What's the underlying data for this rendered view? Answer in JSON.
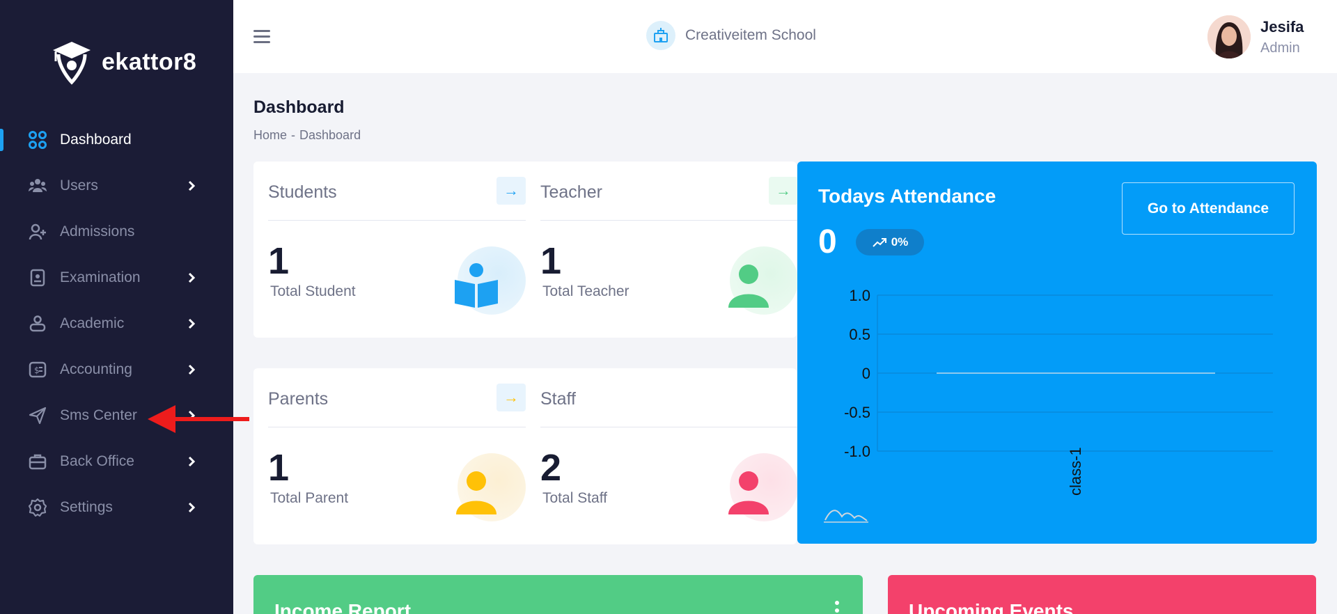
{
  "brand": {
    "name": "ekattor8"
  },
  "sidebar": {
    "items": [
      {
        "label": "Dashboard",
        "icon": "dashboard-grid-icon",
        "active": true,
        "has_submenu": false
      },
      {
        "label": "Users",
        "icon": "users-icon",
        "active": false,
        "has_submenu": true
      },
      {
        "label": "Admissions",
        "icon": "add-user-icon",
        "active": false,
        "has_submenu": false
      },
      {
        "label": "Examination",
        "icon": "exam-icon",
        "active": false,
        "has_submenu": true
      },
      {
        "label": "Academic",
        "icon": "academic-icon",
        "active": false,
        "has_submenu": true
      },
      {
        "label": "Accounting",
        "icon": "accounting-icon",
        "active": false,
        "has_submenu": true
      },
      {
        "label": "Sms Center",
        "icon": "send-icon",
        "active": false,
        "has_submenu": true
      },
      {
        "label": "Back Office",
        "icon": "briefcase-icon",
        "active": false,
        "has_submenu": true
      },
      {
        "label": "Settings",
        "icon": "gear-icon",
        "active": false,
        "has_submenu": true
      }
    ]
  },
  "header": {
    "school_name": "Creativeitem School",
    "user": {
      "name": "Jesifa",
      "role": "Admin"
    }
  },
  "page": {
    "title": "Dashboard",
    "breadcrumb": [
      "Home",
      "Dashboard"
    ],
    "breadcrumb_separator": "-"
  },
  "stats": {
    "students": {
      "title": "Students",
      "value": "1",
      "label": "Total Student",
      "arrow": "→",
      "color": "#1da1f2"
    },
    "teacher": {
      "title": "Teacher",
      "value": "1",
      "label": "Total Teacher",
      "arrow": "→",
      "color": "#52cc85"
    },
    "parents": {
      "title": "Parents",
      "value": "1",
      "label": "Total Parent",
      "arrow": "→",
      "color": "#ffc107"
    },
    "staff": {
      "title": "Staff",
      "value": "2",
      "label": "Total Staff",
      "arrow": "",
      "color": "#f3416b"
    }
  },
  "attendance": {
    "title": "Todays Attendance",
    "count": "0",
    "change": "0%",
    "button_label": "Go to Attendance",
    "color": "#039cf8"
  },
  "chart_data": {
    "type": "line",
    "categories": [
      "class-1"
    ],
    "series": [
      {
        "values": [
          0
        ]
      }
    ],
    "ylim": [
      -1.0,
      1.0
    ],
    "yticks": [
      "1.0",
      "0.5",
      "0",
      "-0.5",
      "-1.0"
    ],
    "grid": true
  },
  "income": {
    "title": "Income Report",
    "color": "#52cc85"
  },
  "events": {
    "title": "Upcoming Events",
    "color": "#f3416b"
  }
}
